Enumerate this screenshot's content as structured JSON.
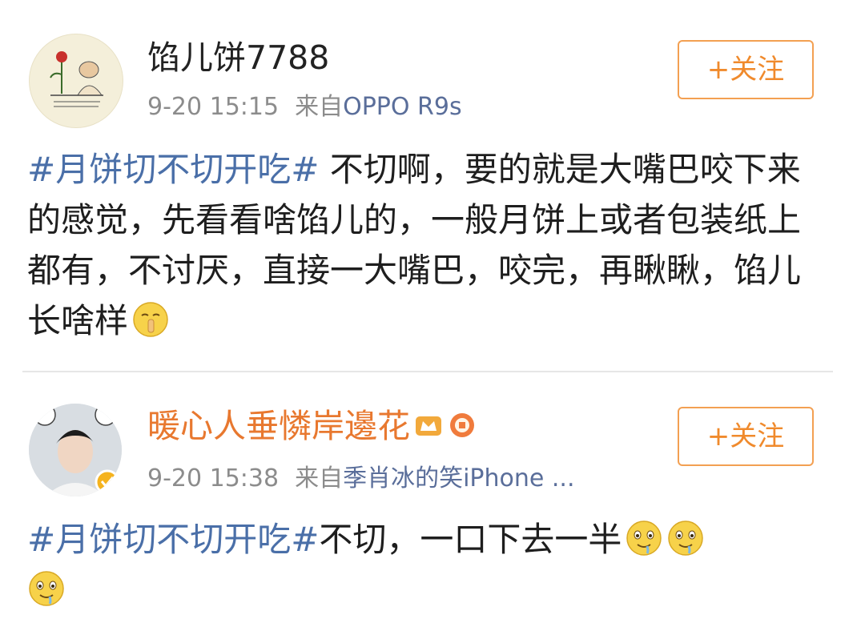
{
  "posts": [
    {
      "username": "馅儿饼7788",
      "time": "9-20 15:15",
      "source_prefix": "来自",
      "source": "OPPO R9s",
      "follow_label": "+关注",
      "topic": "#月饼切不切开吃#",
      "text": " 不切啊，要的就是大嘴巴咬下来的感觉，先看看啥馅儿的，一般月饼上或者包装纸上都有，不讨厌，直接一大嘴巴，咬完，再瞅瞅，馅儿长啥样",
      "emojis": [
        "shush-emoji"
      ]
    },
    {
      "username": "暖心人垂憐岸邊花",
      "time": "9-20 15:38",
      "source_prefix": "来自",
      "source": "季肖冰的笑iPhone ...",
      "follow_label": "+关注",
      "topic": "#月饼切不切开吃#",
      "text": "不切，一口下去一半",
      "emojis": [
        "drool-emoji",
        "drool-emoji",
        "drool-emoji"
      ]
    }
  ],
  "colors": {
    "topic": "#4a6fa8",
    "username_vip": "#e8782f",
    "follow": "#f08a2c",
    "meta": "#8c8c8c"
  }
}
